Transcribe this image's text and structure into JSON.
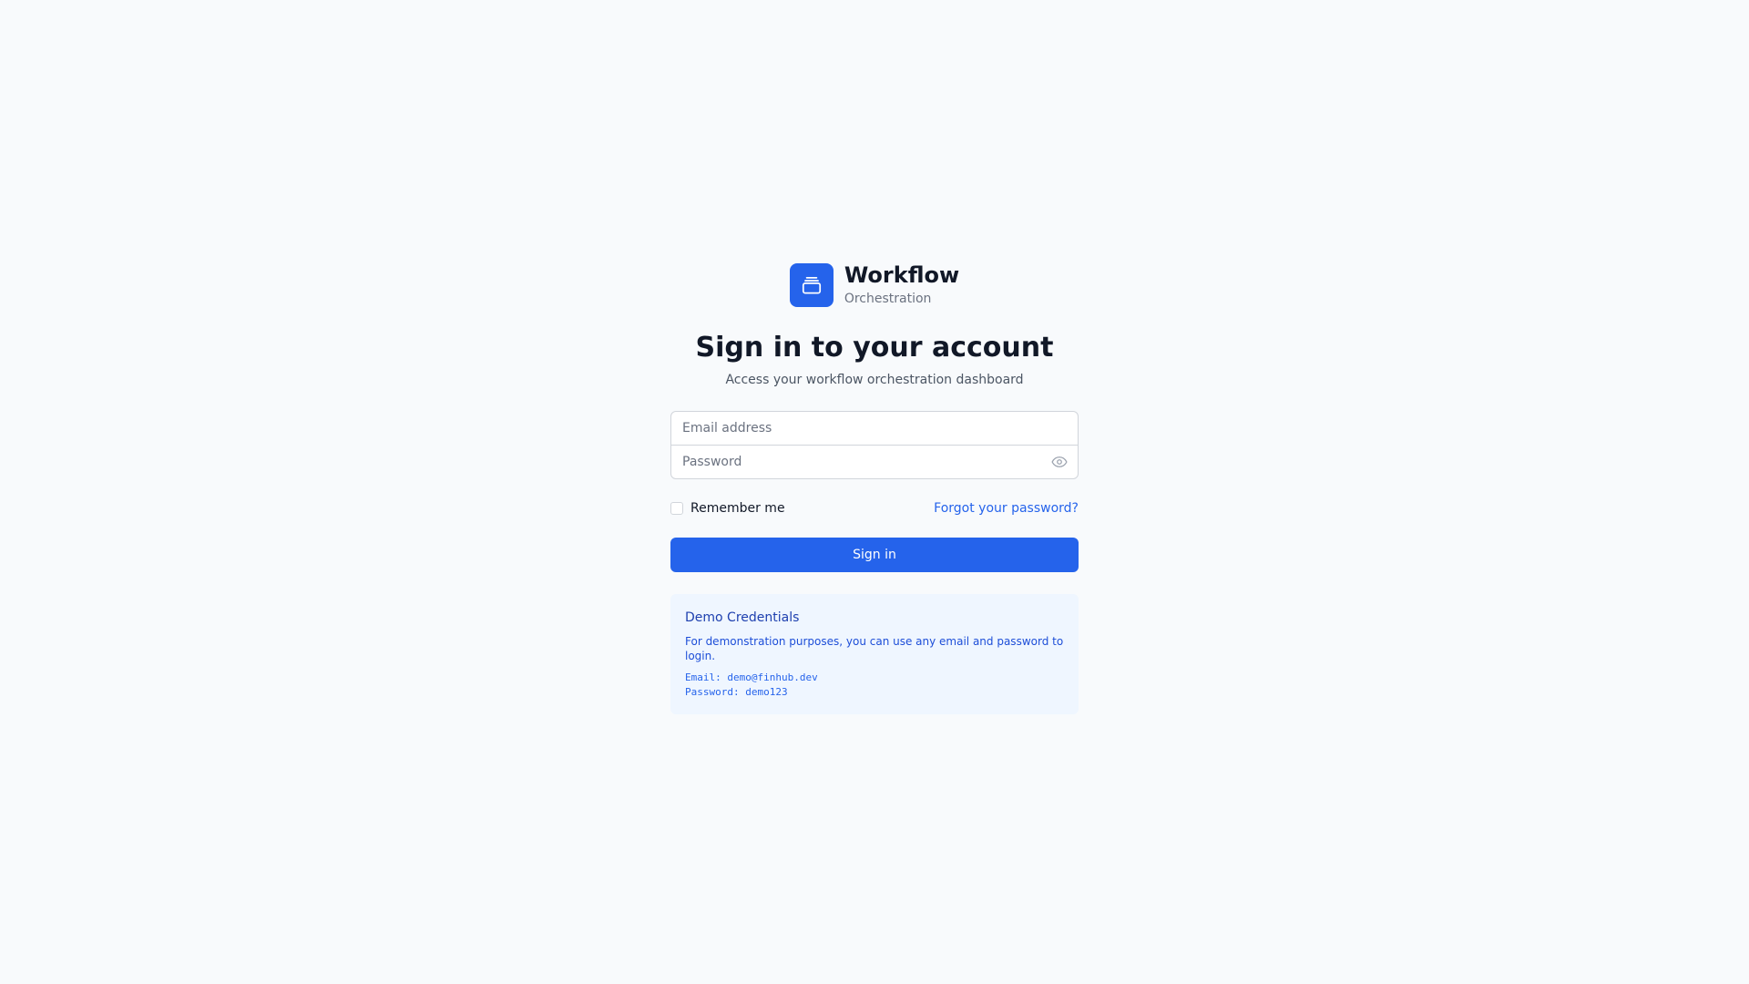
{
  "brand": {
    "name": "Workflow",
    "subtitle": "Orchestration",
    "logo_icon": "archive-box-icon",
    "accent_color": "#2563eb"
  },
  "heading": "Sign in to your account",
  "subheading": "Access your workflow orchestration dashboard",
  "form": {
    "email_placeholder": "Email address",
    "email_value": "",
    "password_placeholder": "Password",
    "password_value": "",
    "password_toggle_icon": "eye-icon",
    "remember_label": "Remember me",
    "remember_checked": false,
    "forgot_label": "Forgot your password?",
    "submit_label": "Sign in"
  },
  "demo": {
    "title": "Demo Credentials",
    "description": "For demonstration purposes, you can use any email and password to login.",
    "email_line": "Email: demo@finhub.dev",
    "password_line": "Password: demo123"
  }
}
